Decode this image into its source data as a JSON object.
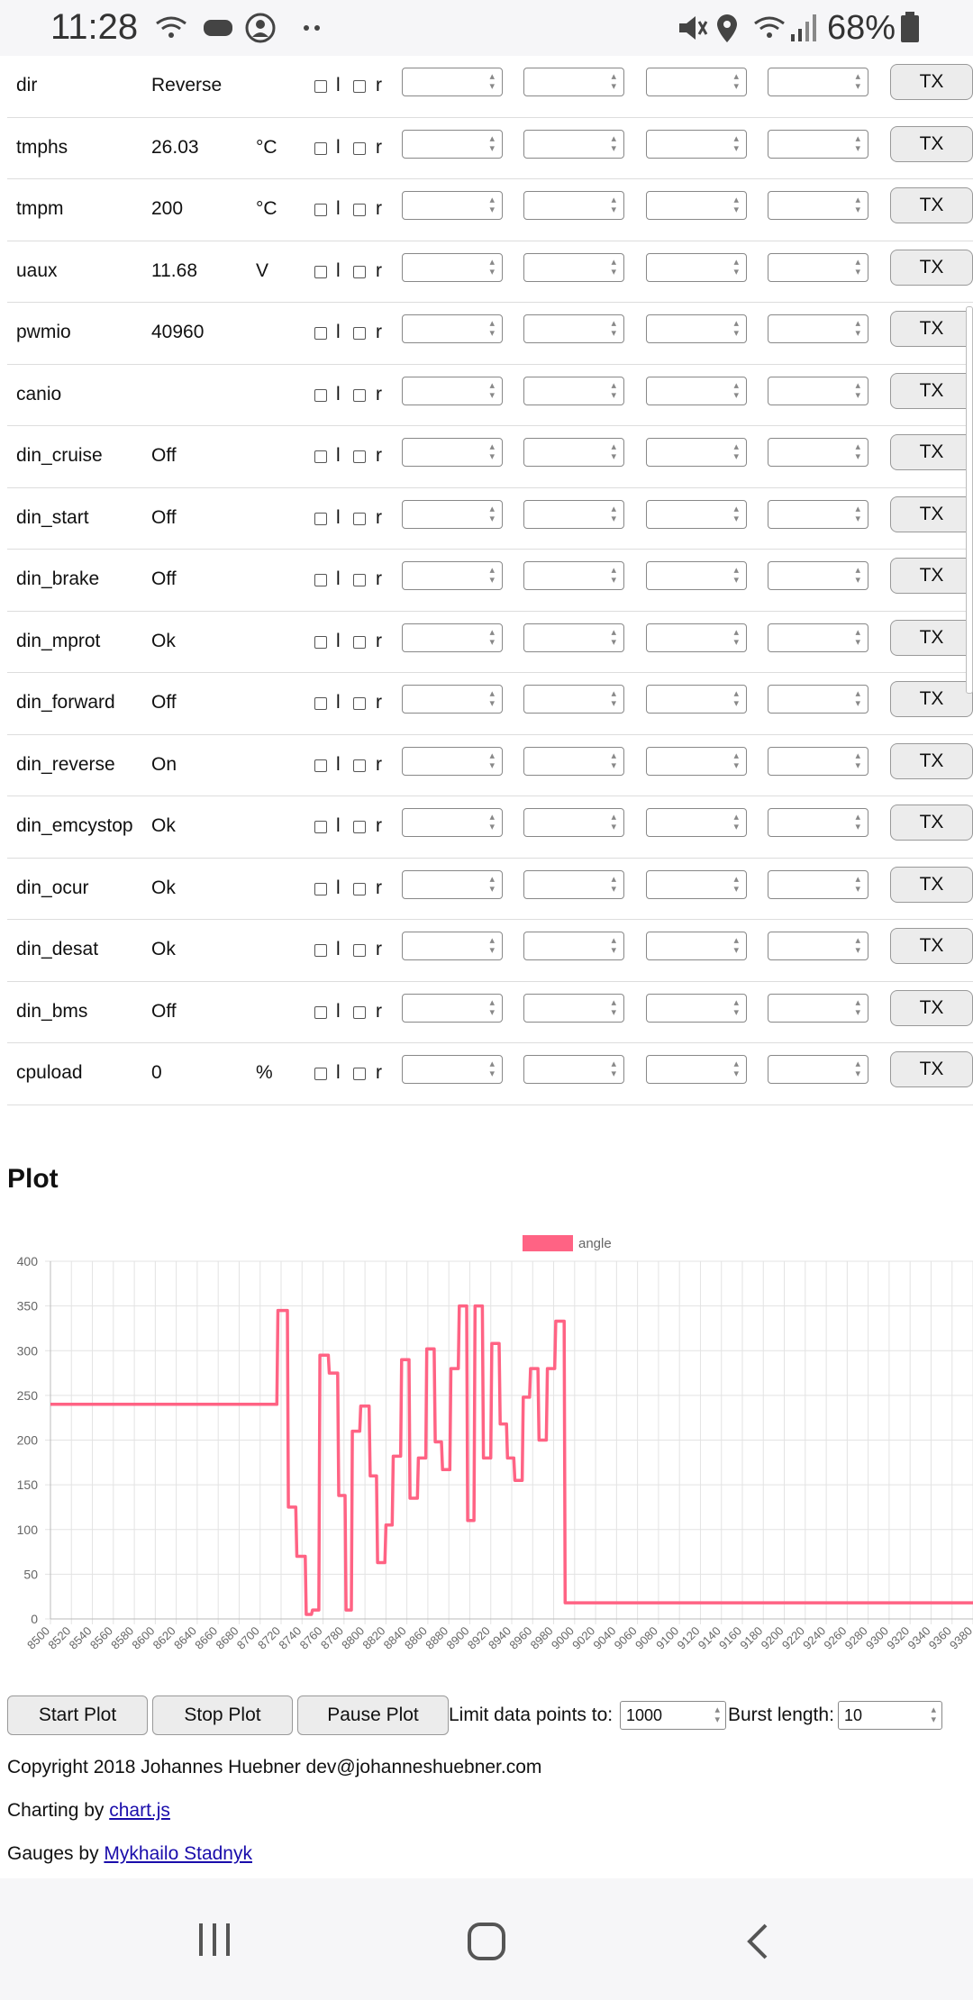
{
  "status_bar": {
    "time": "11:28",
    "battery_pct": "68%",
    "icons": [
      "wifi-icon",
      "game-controller-icon",
      "account-icon",
      "more-dots-icon",
      "mute-icon",
      "location-icon",
      "wifi-signal-icon",
      "cell-signal-icon",
      "battery-icon"
    ]
  },
  "param_rows": [
    {
      "name": "dir",
      "value": "Reverse",
      "unit": ""
    },
    {
      "name": "tmphs",
      "value": "26.03",
      "unit": "°C"
    },
    {
      "name": "tmpm",
      "value": "200",
      "unit": "°C"
    },
    {
      "name": "uaux",
      "value": "11.68",
      "unit": "V"
    },
    {
      "name": "pwmio",
      "value": "40960",
      "unit": ""
    },
    {
      "name": "canio",
      "value": "",
      "unit": ""
    },
    {
      "name": "din_cruise",
      "value": "Off",
      "unit": ""
    },
    {
      "name": "din_start",
      "value": "Off",
      "unit": ""
    },
    {
      "name": "din_brake",
      "value": "Off",
      "unit": ""
    },
    {
      "name": "din_mprot",
      "value": "Ok",
      "unit": ""
    },
    {
      "name": "din_forward",
      "value": "Off",
      "unit": ""
    },
    {
      "name": "din_reverse",
      "value": "On",
      "unit": ""
    },
    {
      "name": "din_emcystop",
      "value": "Ok",
      "unit": ""
    },
    {
      "name": "din_ocur",
      "value": "Ok",
      "unit": ""
    },
    {
      "name": "din_desat",
      "value": "Ok",
      "unit": ""
    },
    {
      "name": "din_bms",
      "value": "Off",
      "unit": ""
    },
    {
      "name": "cpuload",
      "value": "0",
      "unit": "%"
    }
  ],
  "row_labels": {
    "l": "l",
    "r": "r",
    "tx": "TX"
  },
  "plot": {
    "title": "Plot"
  },
  "chart_data": {
    "type": "line",
    "series": [
      {
        "name": "angle",
        "color": "#ff6384"
      }
    ],
    "ylim": [
      0,
      400
    ],
    "yticks": [
      0,
      50,
      100,
      150,
      200,
      250,
      300,
      350,
      400
    ],
    "xticks": [
      8500,
      8520,
      8540,
      8560,
      8580,
      8600,
      8620,
      8640,
      8660,
      8680,
      8700,
      8720,
      8740,
      8760,
      8780,
      8800,
      8820,
      8840,
      8860,
      8880,
      8900,
      8920,
      8940,
      8960,
      8980,
      9000,
      9020,
      9040,
      9060,
      9080,
      9100,
      9120,
      9140,
      9160,
      9180,
      9200,
      9220,
      9240,
      9260,
      9280,
      9300,
      9320,
      9340,
      9360,
      9380
    ],
    "xlim": [
      8500,
      9380
    ],
    "points": [
      [
        8500,
        240
      ],
      [
        8716,
        240
      ],
      [
        8717,
        345
      ],
      [
        8726,
        345
      ],
      [
        8727,
        125
      ],
      [
        8734,
        125
      ],
      [
        8735,
        70
      ],
      [
        8743,
        70
      ],
      [
        8744,
        5
      ],
      [
        8749,
        5
      ],
      [
        8750,
        10
      ],
      [
        8756,
        10
      ],
      [
        8757,
        295
      ],
      [
        8765,
        295
      ],
      [
        8766,
        275
      ],
      [
        8774,
        275
      ],
      [
        8775,
        138
      ],
      [
        8781,
        138
      ],
      [
        8782,
        10
      ],
      [
        8787,
        10
      ],
      [
        8788,
        210
      ],
      [
        8795,
        210
      ],
      [
        8796,
        238
      ],
      [
        8804,
        238
      ],
      [
        8805,
        160
      ],
      [
        8811,
        160
      ],
      [
        8812,
        63
      ],
      [
        8819,
        63
      ],
      [
        8820,
        105
      ],
      [
        8826,
        105
      ],
      [
        8827,
        182
      ],
      [
        8834,
        182
      ],
      [
        8835,
        290
      ],
      [
        8842,
        290
      ],
      [
        8843,
        135
      ],
      [
        8850,
        135
      ],
      [
        8851,
        180
      ],
      [
        8858,
        180
      ],
      [
        8859,
        302
      ],
      [
        8866,
        302
      ],
      [
        8867,
        198
      ],
      [
        8873,
        198
      ],
      [
        8874,
        167
      ],
      [
        8881,
        167
      ],
      [
        8882,
        280
      ],
      [
        8889,
        280
      ],
      [
        8890,
        350
      ],
      [
        8897,
        350
      ],
      [
        8898,
        110
      ],
      [
        8904,
        110
      ],
      [
        8905,
        350
      ],
      [
        8912,
        350
      ],
      [
        8913,
        180
      ],
      [
        8920,
        180
      ],
      [
        8921,
        308
      ],
      [
        8928,
        308
      ],
      [
        8929,
        218
      ],
      [
        8935,
        218
      ],
      [
        8936,
        180
      ],
      [
        8942,
        180
      ],
      [
        8943,
        155
      ],
      [
        8950,
        155
      ],
      [
        8951,
        248
      ],
      [
        8957,
        248
      ],
      [
        8958,
        280
      ],
      [
        8965,
        280
      ],
      [
        8966,
        200
      ],
      [
        8973,
        200
      ],
      [
        8974,
        280
      ],
      [
        8981,
        280
      ],
      [
        8982,
        333
      ],
      [
        8990,
        333
      ],
      [
        8991,
        18
      ],
      [
        9380,
        18
      ]
    ]
  },
  "controls": {
    "start": "Start Plot",
    "stop": "Stop Plot",
    "pause": "Pause Plot",
    "limit_label": "Limit data points to:",
    "limit_value": "1000",
    "burst_label": "Burst length:",
    "burst_value": "10"
  },
  "footer": {
    "copyright": "Copyright 2018 Johannes Huebner dev@johanneshuebner.com",
    "charting_prefix": "Charting by ",
    "charting_link": "chart.js",
    "gauges_prefix": "Gauges by ",
    "gauges_link": "Mykhailo Stadnyk"
  },
  "nav": {
    "icons": [
      "recent-apps-icon",
      "home-icon",
      "back-icon"
    ]
  }
}
